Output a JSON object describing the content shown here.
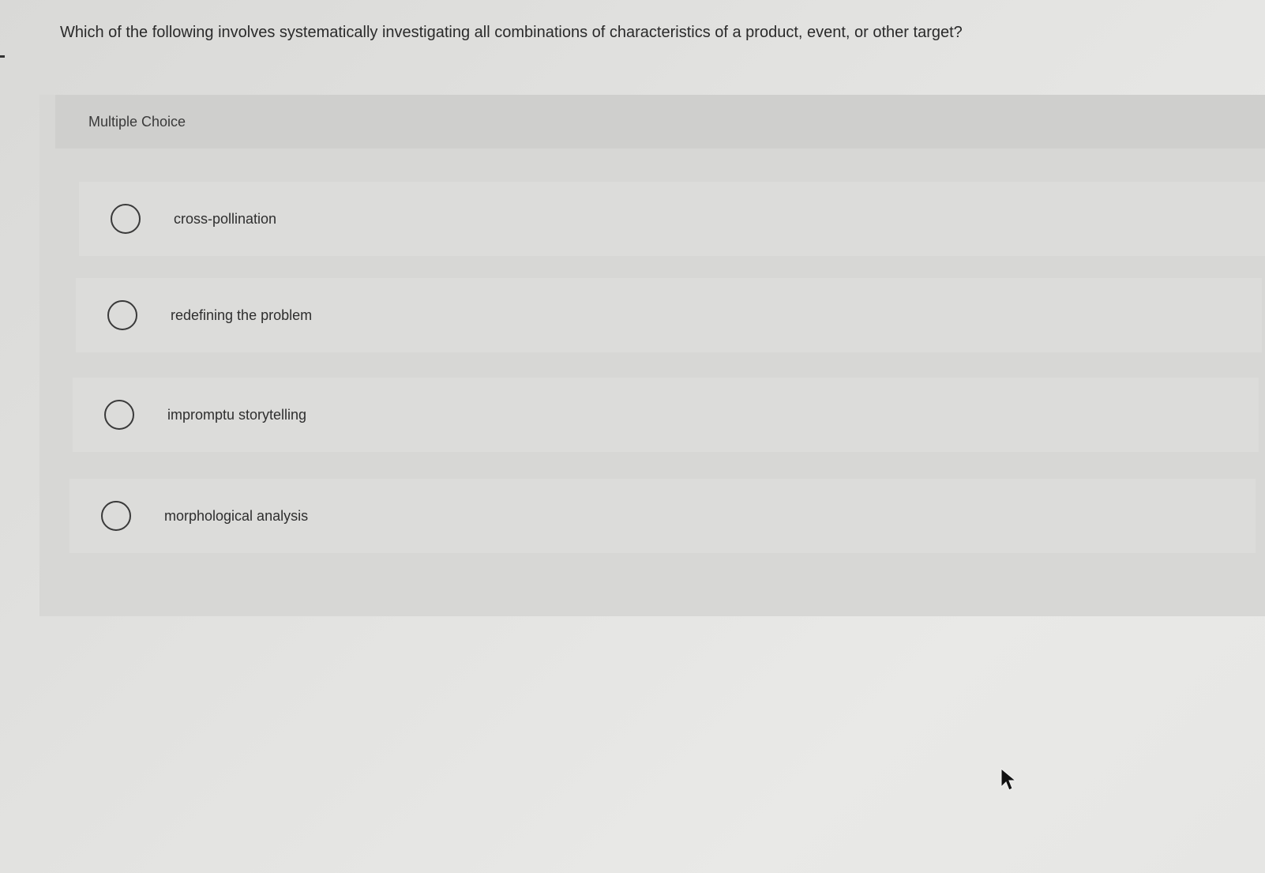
{
  "question": {
    "text": "Which of the following involves systematically investigating all combinations of characteristics of a product, event, or other target?"
  },
  "multiple_choice": {
    "label": "Multiple Choice",
    "options": [
      {
        "label": "cross-pollination",
        "selected": false
      },
      {
        "label": "redefining the problem",
        "selected": false
      },
      {
        "label": "impromptu storytelling",
        "selected": false
      },
      {
        "label": "morphological analysis",
        "selected": false
      }
    ]
  },
  "icons": {
    "radio": "radio-button-icon",
    "cursor": "mouse-pointer-icon"
  },
  "colors": {
    "background": "#e3e3e1",
    "panel": "#d7d7d5",
    "text": "#2b2b2b"
  }
}
